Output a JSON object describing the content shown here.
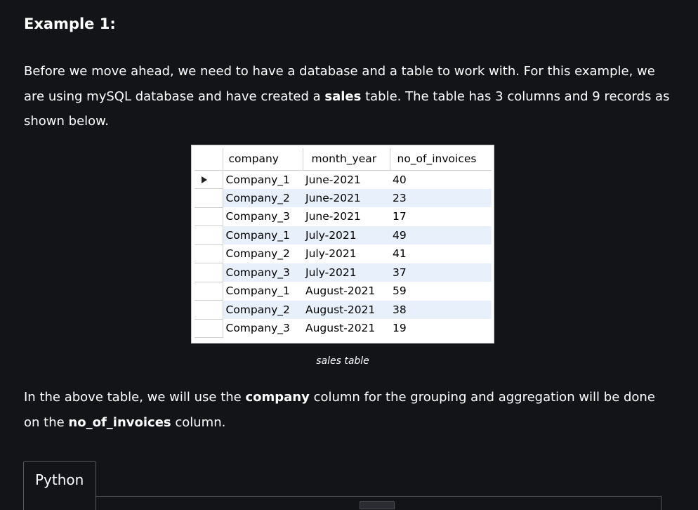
{
  "heading": "Example 1:",
  "para1": {
    "text1": "Before we move ahead, we need to have a database and a table to work with. For this example, we are using mySQL database and have created a ",
    "bold1": "sales",
    "text2": " table. The table has 3 columns and 9 records as shown below."
  },
  "table": {
    "columns": [
      "company",
      "month_year",
      "no_of_invoices"
    ],
    "rows": [
      [
        "Company_1",
        "June-2021",
        "40"
      ],
      [
        "Company_2",
        "June-2021",
        "23"
      ],
      [
        "Company_3",
        "June-2021",
        "17"
      ],
      [
        "Company_1",
        "July-2021",
        "49"
      ],
      [
        "Company_2",
        "July-2021",
        "41"
      ],
      [
        "Company_3",
        "July-2021",
        "37"
      ],
      [
        "Company_1",
        "August-2021",
        "59"
      ],
      [
        "Company_2",
        "August-2021",
        "38"
      ],
      [
        "Company_3",
        "August-2021",
        "19"
      ]
    ],
    "row_indicator_icon": "current-row-arrow-icon",
    "alt_row_color": "#e8f0fc"
  },
  "caption": "sales table",
  "para2": {
    "text1": "In the above table, we will use the ",
    "bold1": "company",
    "text2": " column for the grouping and aggregation will be done on the ",
    "bold2": "no_of_invoices",
    "text3": " column."
  },
  "code_tab": {
    "label": "Python"
  },
  "colors": {
    "background": "#131417",
    "text": "#ffffff"
  }
}
